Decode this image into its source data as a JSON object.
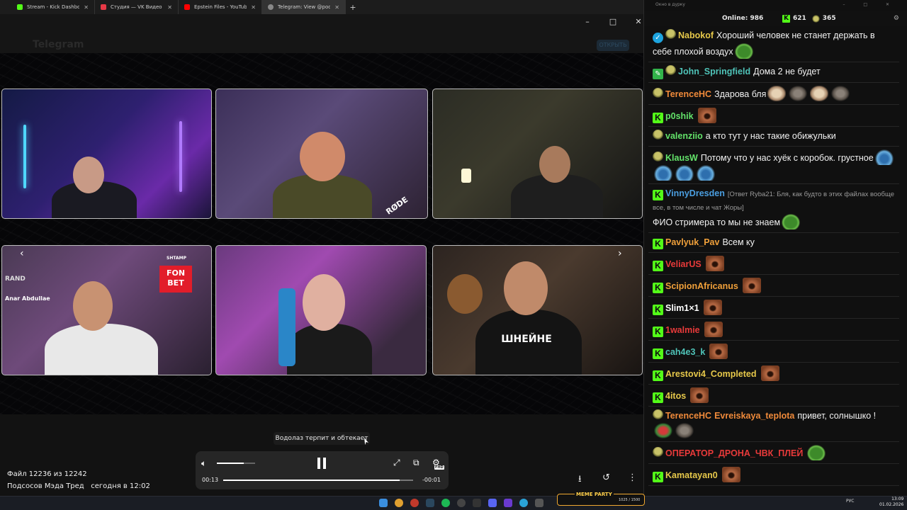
{
  "browser": {
    "tabs": [
      {
        "label": "Stream - Kick Dashboard",
        "color": "#53fc18"
      },
      {
        "label": "Студия — VK Видео Live",
        "color": "#e63946"
      },
      {
        "label": "Epstein Files - YouTube",
        "color": "#ff0000"
      },
      {
        "label": "Telegram: View @podsos_club",
        "color": "#888888"
      }
    ],
    "new_tab": "+"
  },
  "telegram": {
    "header_title": "Telegram",
    "nav_ghost": "Тelegram · podsos_club",
    "open_button": "ОТКРЫТЬ",
    "window_controls": {
      "minimize": "–",
      "maximize": "□",
      "close": "✕"
    }
  },
  "video": {
    "overlays": {
      "fonbet": "FON BET",
      "shtamp": "SHTAMP",
      "rand": "RAND",
      "name_tag": "Anar Abdullae",
      "rode": "RØDE",
      "shirt": "ШНЕЙНЕ"
    },
    "prev_arrow": "‹",
    "next_arrow": "›",
    "caption": "Водолаз терпит и обтекает",
    "current_time": "00:13",
    "remaining_time": "-00:01",
    "volume_level": 0.7,
    "progress": 0.93,
    "quality_badge": "FHD"
  },
  "file_info": {
    "counter": "Файл 12236 из 12242",
    "channel": "Подсосов Мэда Тред",
    "date": "сегодня в 12:02"
  },
  "chat": {
    "window_title": "Окно в дурку",
    "online_label": "Online:",
    "online_count": "986",
    "kick_count": "621",
    "vk_count": "365",
    "messages": [
      {
        "badges": [
          "ver",
          "hat"
        ],
        "user": "Nabokof",
        "color": "#e6c84a",
        "text": "Хороший человек не станет держать в себе плохой воздух",
        "emotes": [
          "pepe"
        ]
      },
      {
        "badges": [
          "mod",
          "hat"
        ],
        "user": "John_Springfield",
        "color": "#4fc3b8",
        "text": "Дома 2 не будет",
        "emotes": []
      },
      {
        "badges": [
          "hat"
        ],
        "user": "TerenceHC",
        "color": "#f08a3a",
        "text": "Здарова бля",
        "emotes": [
          "cat",
          "rat",
          "cat",
          "rat"
        ]
      },
      {
        "badges": [
          "k"
        ],
        "user": "p0shik",
        "color": "#63e36a",
        "text": "",
        "emotes": [
          "face"
        ]
      },
      {
        "badges": [
          "hat"
        ],
        "user": "valenziio",
        "color": "#63e36a",
        "text": "а кто тут у нас такие обижульки",
        "emotes": []
      },
      {
        "badges": [
          "hat"
        ],
        "user": "KlausW",
        "color": "#63e36a",
        "text": "Потому что у нас хуёк с коробок. грустное",
        "emotes": [
          "wave",
          "wave",
          "wave",
          "wave"
        ]
      },
      {
        "badges": [
          "k"
        ],
        "user": "VinnyDresden",
        "color": "#4a9ee0",
        "reply": "[Ответ Ryba21: Бля, как будто в этих файлах вообще все, в том числе и чат Жоры]",
        "text": "ФИО стримера то мы не знаем",
        "emotes": [
          "pepe"
        ]
      },
      {
        "badges": [
          "k"
        ],
        "user": "Pavlyuk_Pav",
        "color": "#f0a03a",
        "text": "Всем ку",
        "emotes": []
      },
      {
        "badges": [
          "k"
        ],
        "user": "VeliarUS",
        "color": "#e83a3a",
        "text": "",
        "emotes": [
          "face"
        ]
      },
      {
        "badges": [
          "k"
        ],
        "user": "ScipionAfricanus",
        "color": "#f0a03a",
        "text": "",
        "emotes": [
          "face"
        ]
      },
      {
        "badges": [
          "k"
        ],
        "user": "Slim1×1",
        "color": "#ffffff",
        "text": "",
        "emotes": [
          "face"
        ]
      },
      {
        "badges": [
          "k"
        ],
        "user": "1walmie",
        "color": "#e83a3a",
        "text": "",
        "emotes": [
          "face"
        ]
      },
      {
        "badges": [
          "k"
        ],
        "user": "cah4e3_k",
        "color": "#4fc3b8",
        "text": "",
        "emotes": [
          "face"
        ]
      },
      {
        "badges": [
          "k"
        ],
        "user": "Arestovi4_Completed",
        "color": "#e6c84a",
        "text": "",
        "emotes": [
          "face"
        ]
      },
      {
        "badges": [
          "k"
        ],
        "user": "4itos",
        "color": "#e6c84a",
        "text": "",
        "emotes": [
          "face"
        ]
      },
      {
        "badges": [
          "hat"
        ],
        "user": "TerenceHC",
        "color": "#f08a3a",
        "mention": "Evreiskaya_teplota",
        "mention_color": "#f08a3a",
        "text": "привет, солнышко !",
        "emotes": [
          "gift",
          "rat"
        ]
      },
      {
        "badges": [
          "hat"
        ],
        "user": "ОПЕРАТОР_ДРОНА_ЧВК_ПЛЕЙ",
        "color": "#e83a3a",
        "text": "",
        "emotes": [
          "pepe"
        ]
      },
      {
        "badges": [
          "k"
        ],
        "user": "Kamatayan0",
        "color": "#e6c84a",
        "text": "",
        "emotes": [
          "face"
        ]
      }
    ]
  },
  "taskbar": {
    "meme_label": "MEME PARTY",
    "meme_count": "1025 / 1500",
    "lang": "РУС",
    "time": "13:09",
    "date": "01.02.2026"
  }
}
